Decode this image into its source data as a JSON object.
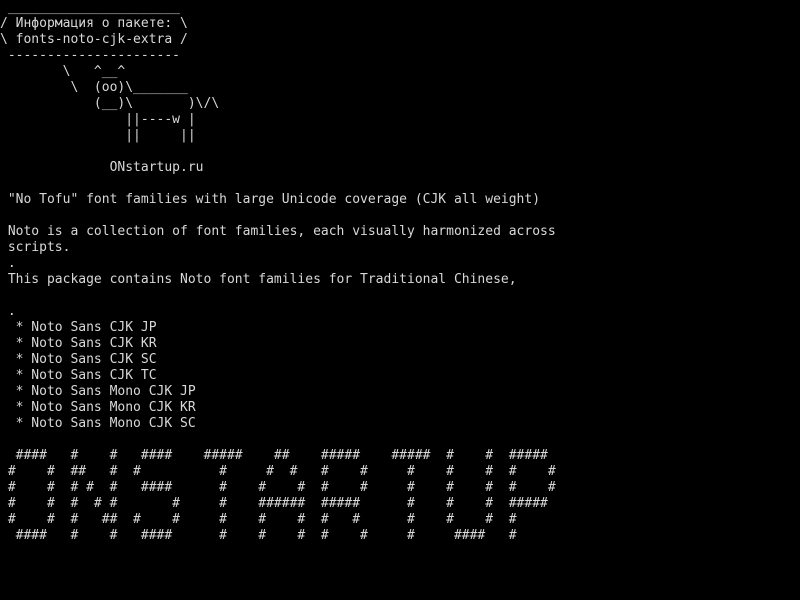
{
  "terminal": {
    "foreground": "#d8d8d8",
    "background": "#000000",
    "lines": [
      " ______________________",
      "/ Информация о пакете: \\",
      "\\ fonts-noto-cjk-extra /",
      " ----------------------",
      "        \\   ^__^",
      "         \\  (oo)\\_______",
      "            (__)\\       )\\/\\",
      "                ||----w |",
      "                ||     ||",
      "",
      "              ONstartup.ru",
      "",
      " \"No Tofu\" font families with large Unicode coverage (CJK all weight)",
      "",
      " Noto is a collection of font families, each visually harmonized across",
      " scripts.",
      " .",
      " This package contains Noto font families for Traditional Chinese,",
      "",
      "",
      " .",
      "  * Noto Sans CJK JP",
      "  * Noto Sans CJK KR",
      "  * Noto Sans CJK SC",
      "  * Noto Sans CJK TC",
      "  * Noto Sans Mono CJK JP",
      "  * Noto Sans Mono CJK KR",
      "  * Noto Sans Mono CJK SC",
      "",
      "  ####   #    #   ####    #####    ##    #####    #####  #    #  #####",
      " #    #  ##   #  #          #     #  #   #    #     #    #    #  #    #",
      " #    #  # #  #   ####      #    #    #  #    #     #    #    #  #    #",
      " #    #  #  # #       #     #    ######  #####      #    #    #  #####",
      " #    #  #   ##  #    #     #    #    #  #   #      #    #    #  #",
      "  ####   #    #   ####      #    #    #  #    #     #     ####   #"
    ]
  }
}
